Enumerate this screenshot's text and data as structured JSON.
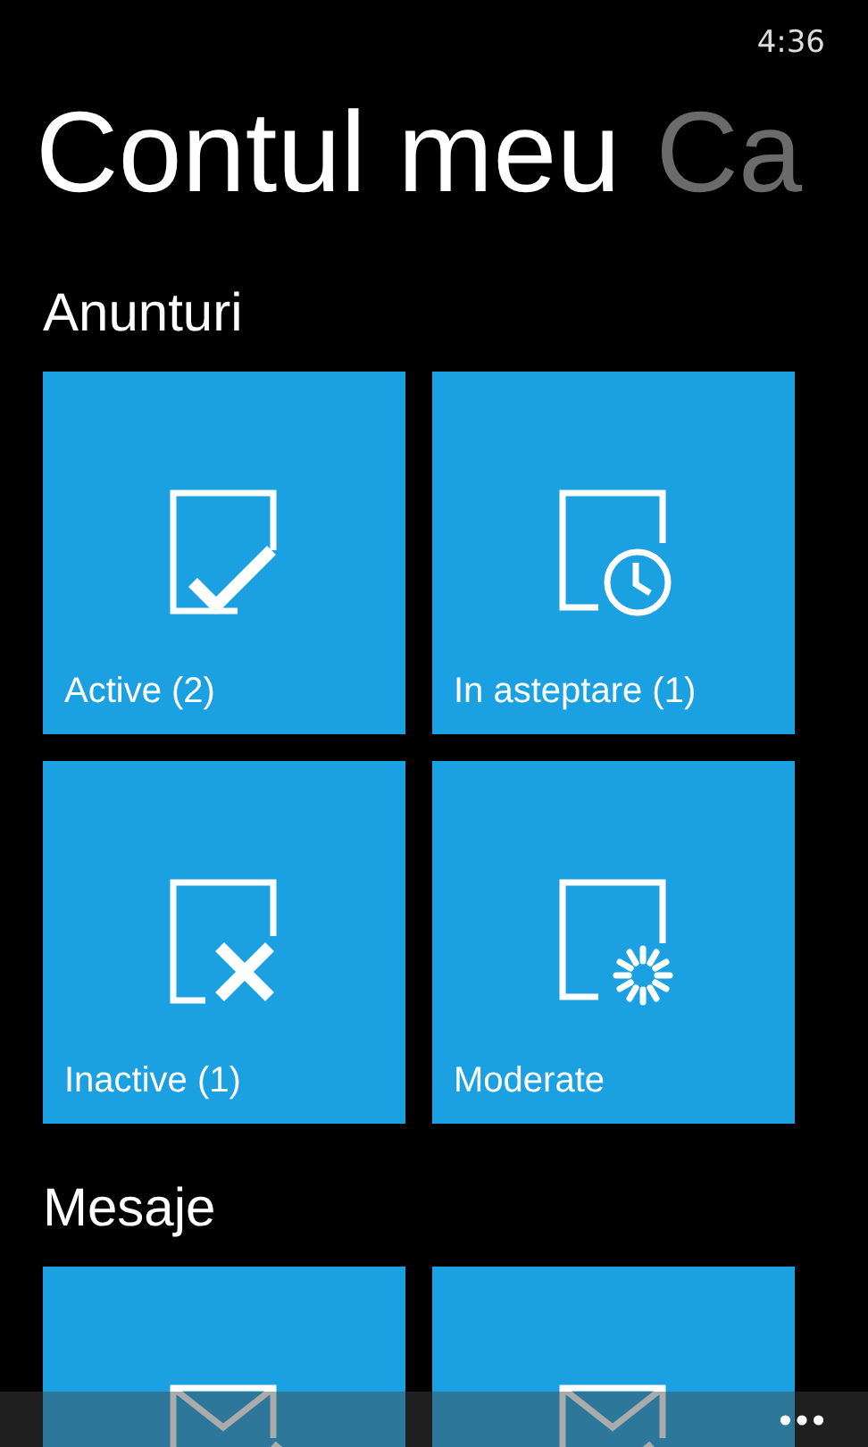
{
  "status_bar": {
    "time": "4:36"
  },
  "pivot": [
    {
      "label": "Contul meu",
      "selected": true
    },
    {
      "label": "Ca",
      "selected": false
    }
  ],
  "sections": [
    {
      "title": "Anunturi",
      "tiles": [
        {
          "label": "Active (2)",
          "kind": "check"
        },
        {
          "label": "In asteptare (1)",
          "kind": "clock"
        },
        {
          "label": "Inactive (1)",
          "kind": "cross"
        },
        {
          "label": "Moderate",
          "kind": "spinner"
        }
      ]
    },
    {
      "title": "Mesaje",
      "tiles": [
        {
          "kind": "mailleft"
        },
        {
          "kind": "mailright"
        }
      ]
    }
  ]
}
